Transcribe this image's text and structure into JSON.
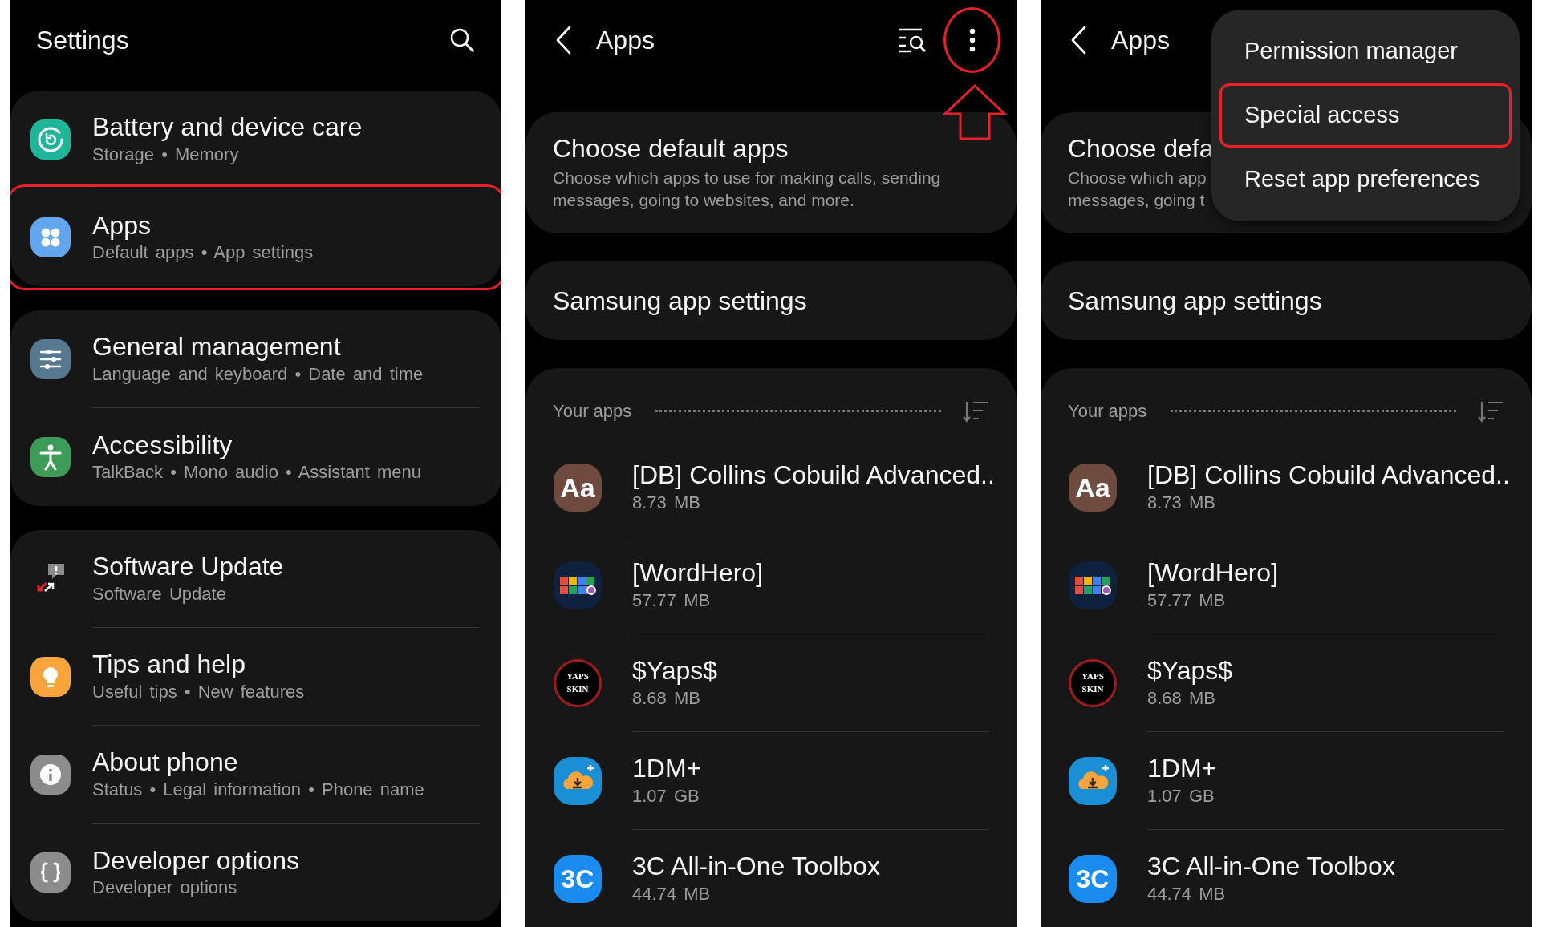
{
  "panels": [
    {
      "kind": "settings",
      "title": "Settings",
      "groups": [
        {
          "items": [
            {
              "kind": "battery",
              "title": "Battery and device care",
              "subtitle": "Storage • Memory",
              "highlighted": false
            },
            {
              "kind": "apps",
              "title": "Apps",
              "subtitle": "Default apps • App settings",
              "highlighted": true
            }
          ]
        },
        {
          "items": [
            {
              "kind": "general",
              "title": "General management",
              "subtitle": "Language and keyboard • Date and time",
              "highlighted": false
            },
            {
              "kind": "accessibility",
              "title": "Accessibility",
              "subtitle": "TalkBack • Mono audio • Assistant menu",
              "highlighted": false
            }
          ]
        },
        {
          "items": [
            {
              "kind": "update",
              "title": "Software Update",
              "subtitle": "Software Update",
              "highlighted": false
            },
            {
              "kind": "tips",
              "title": "Tips and help",
              "subtitle": "Useful tips • New features",
              "highlighted": false
            },
            {
              "kind": "about",
              "title": "About phone",
              "subtitle": "Status • Legal information • Phone name",
              "highlighted": false
            },
            {
              "kind": "developer",
              "title": "Developer options",
              "subtitle": "Developer options",
              "highlighted": false
            }
          ]
        }
      ]
    },
    {
      "kind": "apps",
      "title": "Apps",
      "more_button_highlighted": true,
      "pointer_arrow": true,
      "cards": [
        {
          "title": "Choose default apps",
          "description": "Choose which apps to use for making calls, sending\nmessages, going to websites, and more."
        },
        {
          "title": "Samsung app settings"
        }
      ],
      "section": {
        "label": "Your apps",
        "apps": [
          {
            "kind": "dictionary",
            "icon_text": [
              "Aa"
            ],
            "name": "[DB] Collins Cobuild Advanced..",
            "size": "8.73 MB"
          },
          {
            "kind": "tiles",
            "name": "[WordHero]",
            "size": "57.77 MB"
          },
          {
            "kind": "badge",
            "icon_text": [
              "YAPS",
              "SKIN"
            ],
            "name": "$Yaps$",
            "size": "8.68 MB"
          },
          {
            "kind": "download",
            "name": "1DM+",
            "size": "1.07 GB"
          },
          {
            "kind": "toolbox",
            "icon_text": [
              "3C"
            ],
            "name": "3C All-in-One Toolbox",
            "size": "44.74 MB"
          }
        ]
      }
    },
    {
      "kind": "apps",
      "title": "Apps",
      "cards": [
        {
          "title": "Choose defa",
          "description": "Choose which app\nmessages, going t"
        },
        {
          "title": "Samsung app settings"
        }
      ],
      "section": {
        "label": "Your apps",
        "apps": [
          {
            "kind": "dictionary",
            "icon_text": [
              "Aa"
            ],
            "name": "[DB] Collins Cobuild Advanced..",
            "size": "8.73 MB"
          },
          {
            "kind": "tiles",
            "name": "[WordHero]",
            "size": "57.77 MB"
          },
          {
            "kind": "badge",
            "icon_text": [
              "YAPS",
              "SKIN"
            ],
            "name": "$Yaps$",
            "size": "8.68 MB"
          },
          {
            "kind": "download",
            "name": "1DM+",
            "size": "1.07 GB"
          },
          {
            "kind": "toolbox",
            "icon_text": [
              "3C"
            ],
            "name": "3C All-in-One Toolbox",
            "size": "44.74 MB"
          }
        ]
      },
      "menu": {
        "items": [
          {
            "label": "Permission manager",
            "highlighted": false
          },
          {
            "label": "Special access",
            "highlighted": true
          },
          {
            "label": "Reset app preferences",
            "highlighted": false
          }
        ]
      }
    }
  ]
}
